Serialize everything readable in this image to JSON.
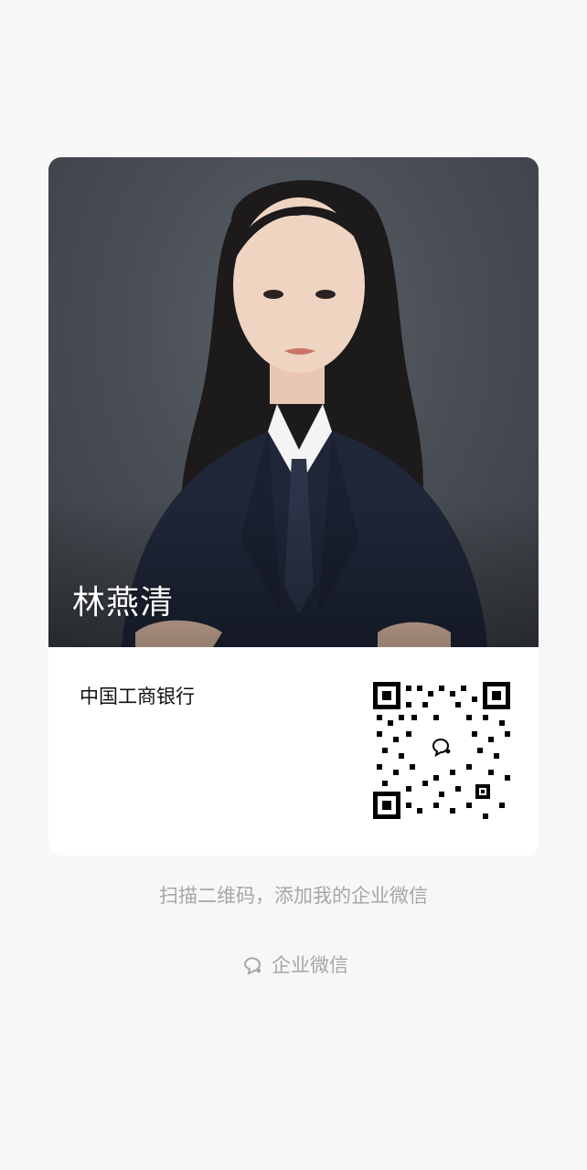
{
  "card": {
    "name": "林燕清",
    "company": "中国工商银行",
    "photo_icon": "portrait-photo",
    "qr_icon": "qr-code-icon"
  },
  "hint": "扫描二维码，添加我的企业微信",
  "brand": {
    "label": "企业微信",
    "icon": "wecom-icon"
  },
  "colors": {
    "page_bg": "#f7f7f7",
    "card_bg": "#ffffff",
    "muted_text": "#a6a6a6"
  }
}
